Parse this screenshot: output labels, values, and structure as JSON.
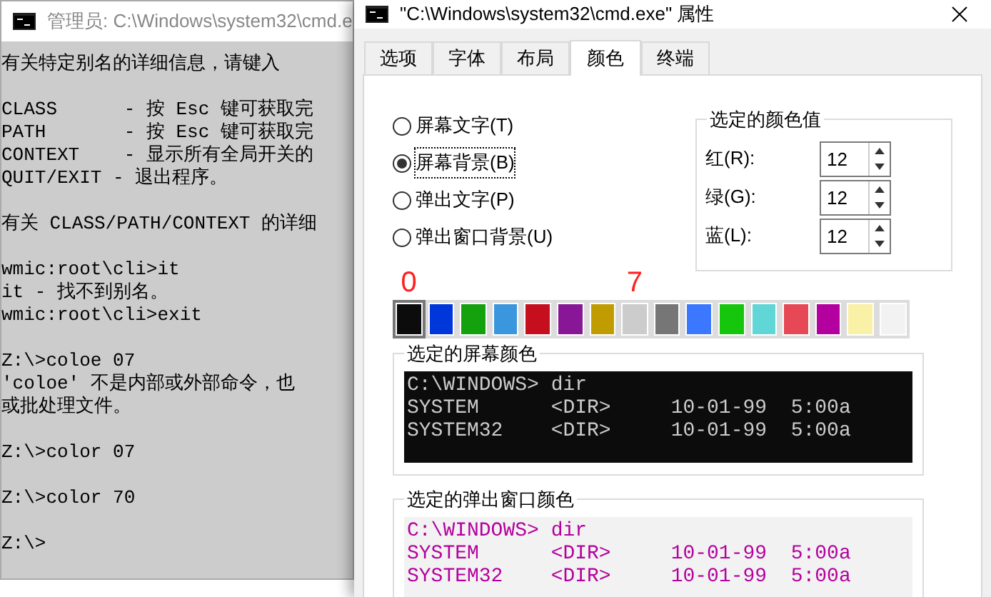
{
  "console_window": {
    "title": "管理员: C:\\Windows\\system32\\cmd.e",
    "blocks": [
      [
        "有关特定别名的详细信息，请键入"
      ],
      [
        "CLASS      - 按 Esc 键可获取完",
        "PATH       - 按 Esc 键可获取完",
        "CONTEXT    - 显示所有全局开关的",
        "QUIT/EXIT - 退出程序。"
      ],
      [
        "有关 CLASS/PATH/CONTEXT 的详细"
      ],
      [
        "wmic:root\\cli>it",
        "it - 找不到别名。",
        "wmic:root\\cli>exit"
      ],
      [
        "Z:\\>coloe 07",
        "'coloe' 不是内部或外部命令，也",
        "或批处理文件。"
      ],
      [
        "Z:\\>color 07"
      ],
      [
        "Z:\\>color 70"
      ],
      [
        "Z:\\>"
      ]
    ]
  },
  "dialog": {
    "title": "\"C:\\Windows\\system32\\cmd.exe\" 属性",
    "tabs": [
      {
        "label": "选项",
        "selected": false
      },
      {
        "label": "字体",
        "selected": false
      },
      {
        "label": "布局",
        "selected": false
      },
      {
        "label": "颜色",
        "selected": true
      },
      {
        "label": "终端",
        "selected": false
      }
    ],
    "radios": [
      {
        "label": "屏幕文字(T)",
        "selected": false
      },
      {
        "label": "屏幕背景(B)",
        "selected": true
      },
      {
        "label": "弹出文字(P)",
        "selected": false
      },
      {
        "label": "弹出窗口背景(U)",
        "selected": false
      }
    ],
    "color_values": {
      "title": "选定的颜色值",
      "fields": [
        {
          "label": "红(R):",
          "value": "12"
        },
        {
          "label": "绿(G):",
          "value": "12"
        },
        {
          "label": "蓝(L):",
          "value": "12"
        }
      ]
    },
    "swatches": [
      {
        "color": "#0c0c0c",
        "selected": true,
        "label": "0"
      },
      {
        "color": "#0037da",
        "selected": false
      },
      {
        "color": "#13a10e",
        "selected": false
      },
      {
        "color": "#3a96dd",
        "selected": false
      },
      {
        "color": "#c50f1f",
        "selected": false
      },
      {
        "color": "#881798",
        "selected": false
      },
      {
        "color": "#c19c00",
        "selected": false
      },
      {
        "color": "#cccccc",
        "selected": false,
        "label": "7"
      },
      {
        "color": "#767676",
        "selected": false
      },
      {
        "color": "#3b78ff",
        "selected": false
      },
      {
        "color": "#16c60c",
        "selected": false
      },
      {
        "color": "#61d6d6",
        "selected": false
      },
      {
        "color": "#e74856",
        "selected": false
      },
      {
        "color": "#b4009e",
        "selected": false
      },
      {
        "color": "#f9f1a5",
        "selected": false
      },
      {
        "color": "#f2f2f2",
        "selected": false
      }
    ],
    "previews": [
      {
        "title": "选定的屏幕颜色",
        "kind": "screen",
        "lines": [
          "C:\\WINDOWS> dir",
          "SYSTEM      <DIR>     10-01-99  5:00a",
          "SYSTEM32    <DIR>     10-01-99  5:00a"
        ]
      },
      {
        "title": "选定的弹出窗口颜色",
        "kind": "popup",
        "lines": [
          "C:\\WINDOWS> dir",
          "SYSTEM      <DIR>     10-01-99  5:00a",
          "SYSTEM32    <DIR>     10-01-99  5:00a"
        ]
      }
    ]
  }
}
